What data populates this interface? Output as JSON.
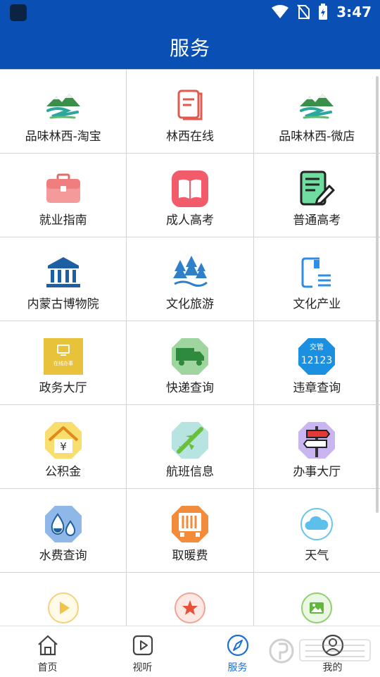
{
  "status": {
    "time": "3:47"
  },
  "header": {
    "title": "服务"
  },
  "grid": [
    [
      {
        "label": "品味林西-淘宝",
        "icon": "landscape-icon"
      },
      {
        "label": "林西在线",
        "icon": "book-icon"
      },
      {
        "label": "品味林西-微店",
        "icon": "landscape-icon"
      }
    ],
    [
      {
        "label": "就业指南",
        "icon": "briefcase-icon"
      },
      {
        "label": "成人高考",
        "icon": "open-book-icon"
      },
      {
        "label": "普通高考",
        "icon": "document-edit-icon"
      }
    ],
    [
      {
        "label": "内蒙古博物院",
        "icon": "museum-icon"
      },
      {
        "label": "文化旅游",
        "icon": "forest-icon"
      },
      {
        "label": "文化产业",
        "icon": "culture-doc-icon"
      }
    ],
    [
      {
        "label": "政务大厅",
        "icon": "gov-hall-icon",
        "inner": "在线办事"
      },
      {
        "label": "快递查询",
        "icon": "delivery-truck-icon"
      },
      {
        "label": "违章查询",
        "icon": "traffic-12123-icon",
        "inner": "交管",
        "inner2": "12123"
      }
    ],
    [
      {
        "label": "公积金",
        "icon": "house-yen-icon",
        "inner": "¥"
      },
      {
        "label": "航班信息",
        "icon": "airplane-icon"
      },
      {
        "label": "办事大厅",
        "icon": "signpost-icon"
      }
    ],
    [
      {
        "label": "水费查询",
        "icon": "water-drop-icon"
      },
      {
        "label": "取暖费",
        "icon": "heater-icon"
      },
      {
        "label": "天气",
        "icon": "cloud-icon"
      }
    ],
    [
      {
        "label": "",
        "icon": "play-circle-icon"
      },
      {
        "label": "",
        "icon": "star-circle-icon"
      },
      {
        "label": "",
        "icon": "image-circle-icon"
      }
    ]
  ],
  "tabs": [
    {
      "label": "首页",
      "icon": "home-icon"
    },
    {
      "label": "视听",
      "icon": "video-play-icon"
    },
    {
      "label": "服务",
      "icon": "compass-icon"
    },
    {
      "label": "我的",
      "icon": "profile-icon"
    }
  ],
  "colors": {
    "primary": "#0a50b4",
    "tab_active": "#1a6fd6"
  }
}
